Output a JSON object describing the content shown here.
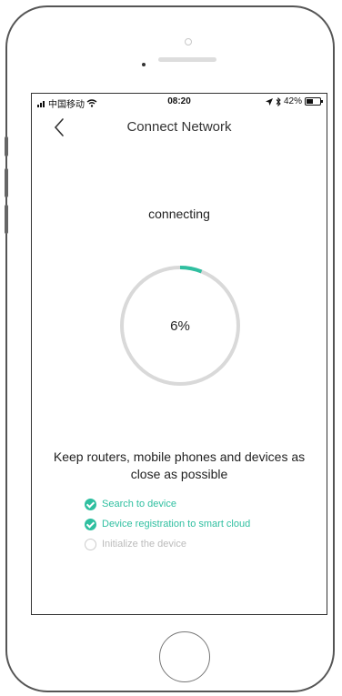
{
  "status_bar": {
    "carrier": "中国移动",
    "time": "08:20",
    "battery": "42%"
  },
  "nav": {
    "title": "Connect Network"
  },
  "main": {
    "status_text": "connecting",
    "progress_label": "6%",
    "progress_value": 0.06,
    "tip": "Keep routers, mobile phones and devices as close as possible",
    "steps": [
      {
        "label": "Search to device",
        "state": "done"
      },
      {
        "label": "Device registration to smart cloud",
        "state": "done"
      },
      {
        "label": "Initialize the device",
        "state": "pending"
      }
    ]
  },
  "colors": {
    "accent": "#2fbfa0",
    "ring_track": "#d9d9d9",
    "pending": "#bbbbbb"
  },
  "icons": [
    "signal-icon",
    "wifi-icon",
    "location-arrow-icon",
    "bluetooth-icon",
    "battery-icon",
    "back-chevron-icon",
    "check-circle-icon"
  ]
}
